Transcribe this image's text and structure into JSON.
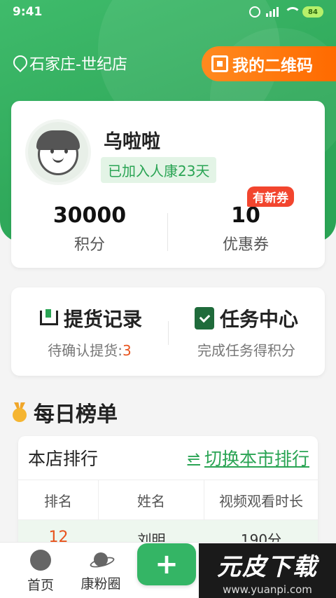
{
  "status_bar": {
    "time": "9:41",
    "battery": "84"
  },
  "header": {
    "location": "石家庄-世纪店",
    "qr_button_label": "我的二维码"
  },
  "profile": {
    "name": "乌啦啦",
    "join_badge": "已加入人康23天",
    "points_value": "30000",
    "points_label": "积分",
    "coupons_value": "10",
    "coupons_label": "优惠券",
    "new_coupon_badge": "有新券"
  },
  "actions": {
    "pickup": {
      "title": "提货记录",
      "subtitle": "待确认提货:",
      "count": "3"
    },
    "tasks": {
      "title": "任务中心",
      "subtitle": "完成任务得积分"
    }
  },
  "daily_ranking": {
    "title": "每日榜单",
    "store_ranking_label": "本店排行",
    "switch_label": "切换本市排行",
    "switch_icon": "⇌",
    "columns": [
      "排名",
      "姓名",
      "视频观看时长"
    ],
    "first_row": {
      "rank": "12",
      "name": "刘明",
      "duration": "190分"
    }
  },
  "tabbar": {
    "home_label": "首页",
    "community_label": "康粉圈",
    "add_label": "+"
  },
  "watermark": {
    "title": "元皮下载",
    "url": "www.yuanpi.com"
  },
  "colors": {
    "brand_green": "#2aa454",
    "accent_orange": "#ff7a10",
    "badge_red": "#f2452e"
  }
}
